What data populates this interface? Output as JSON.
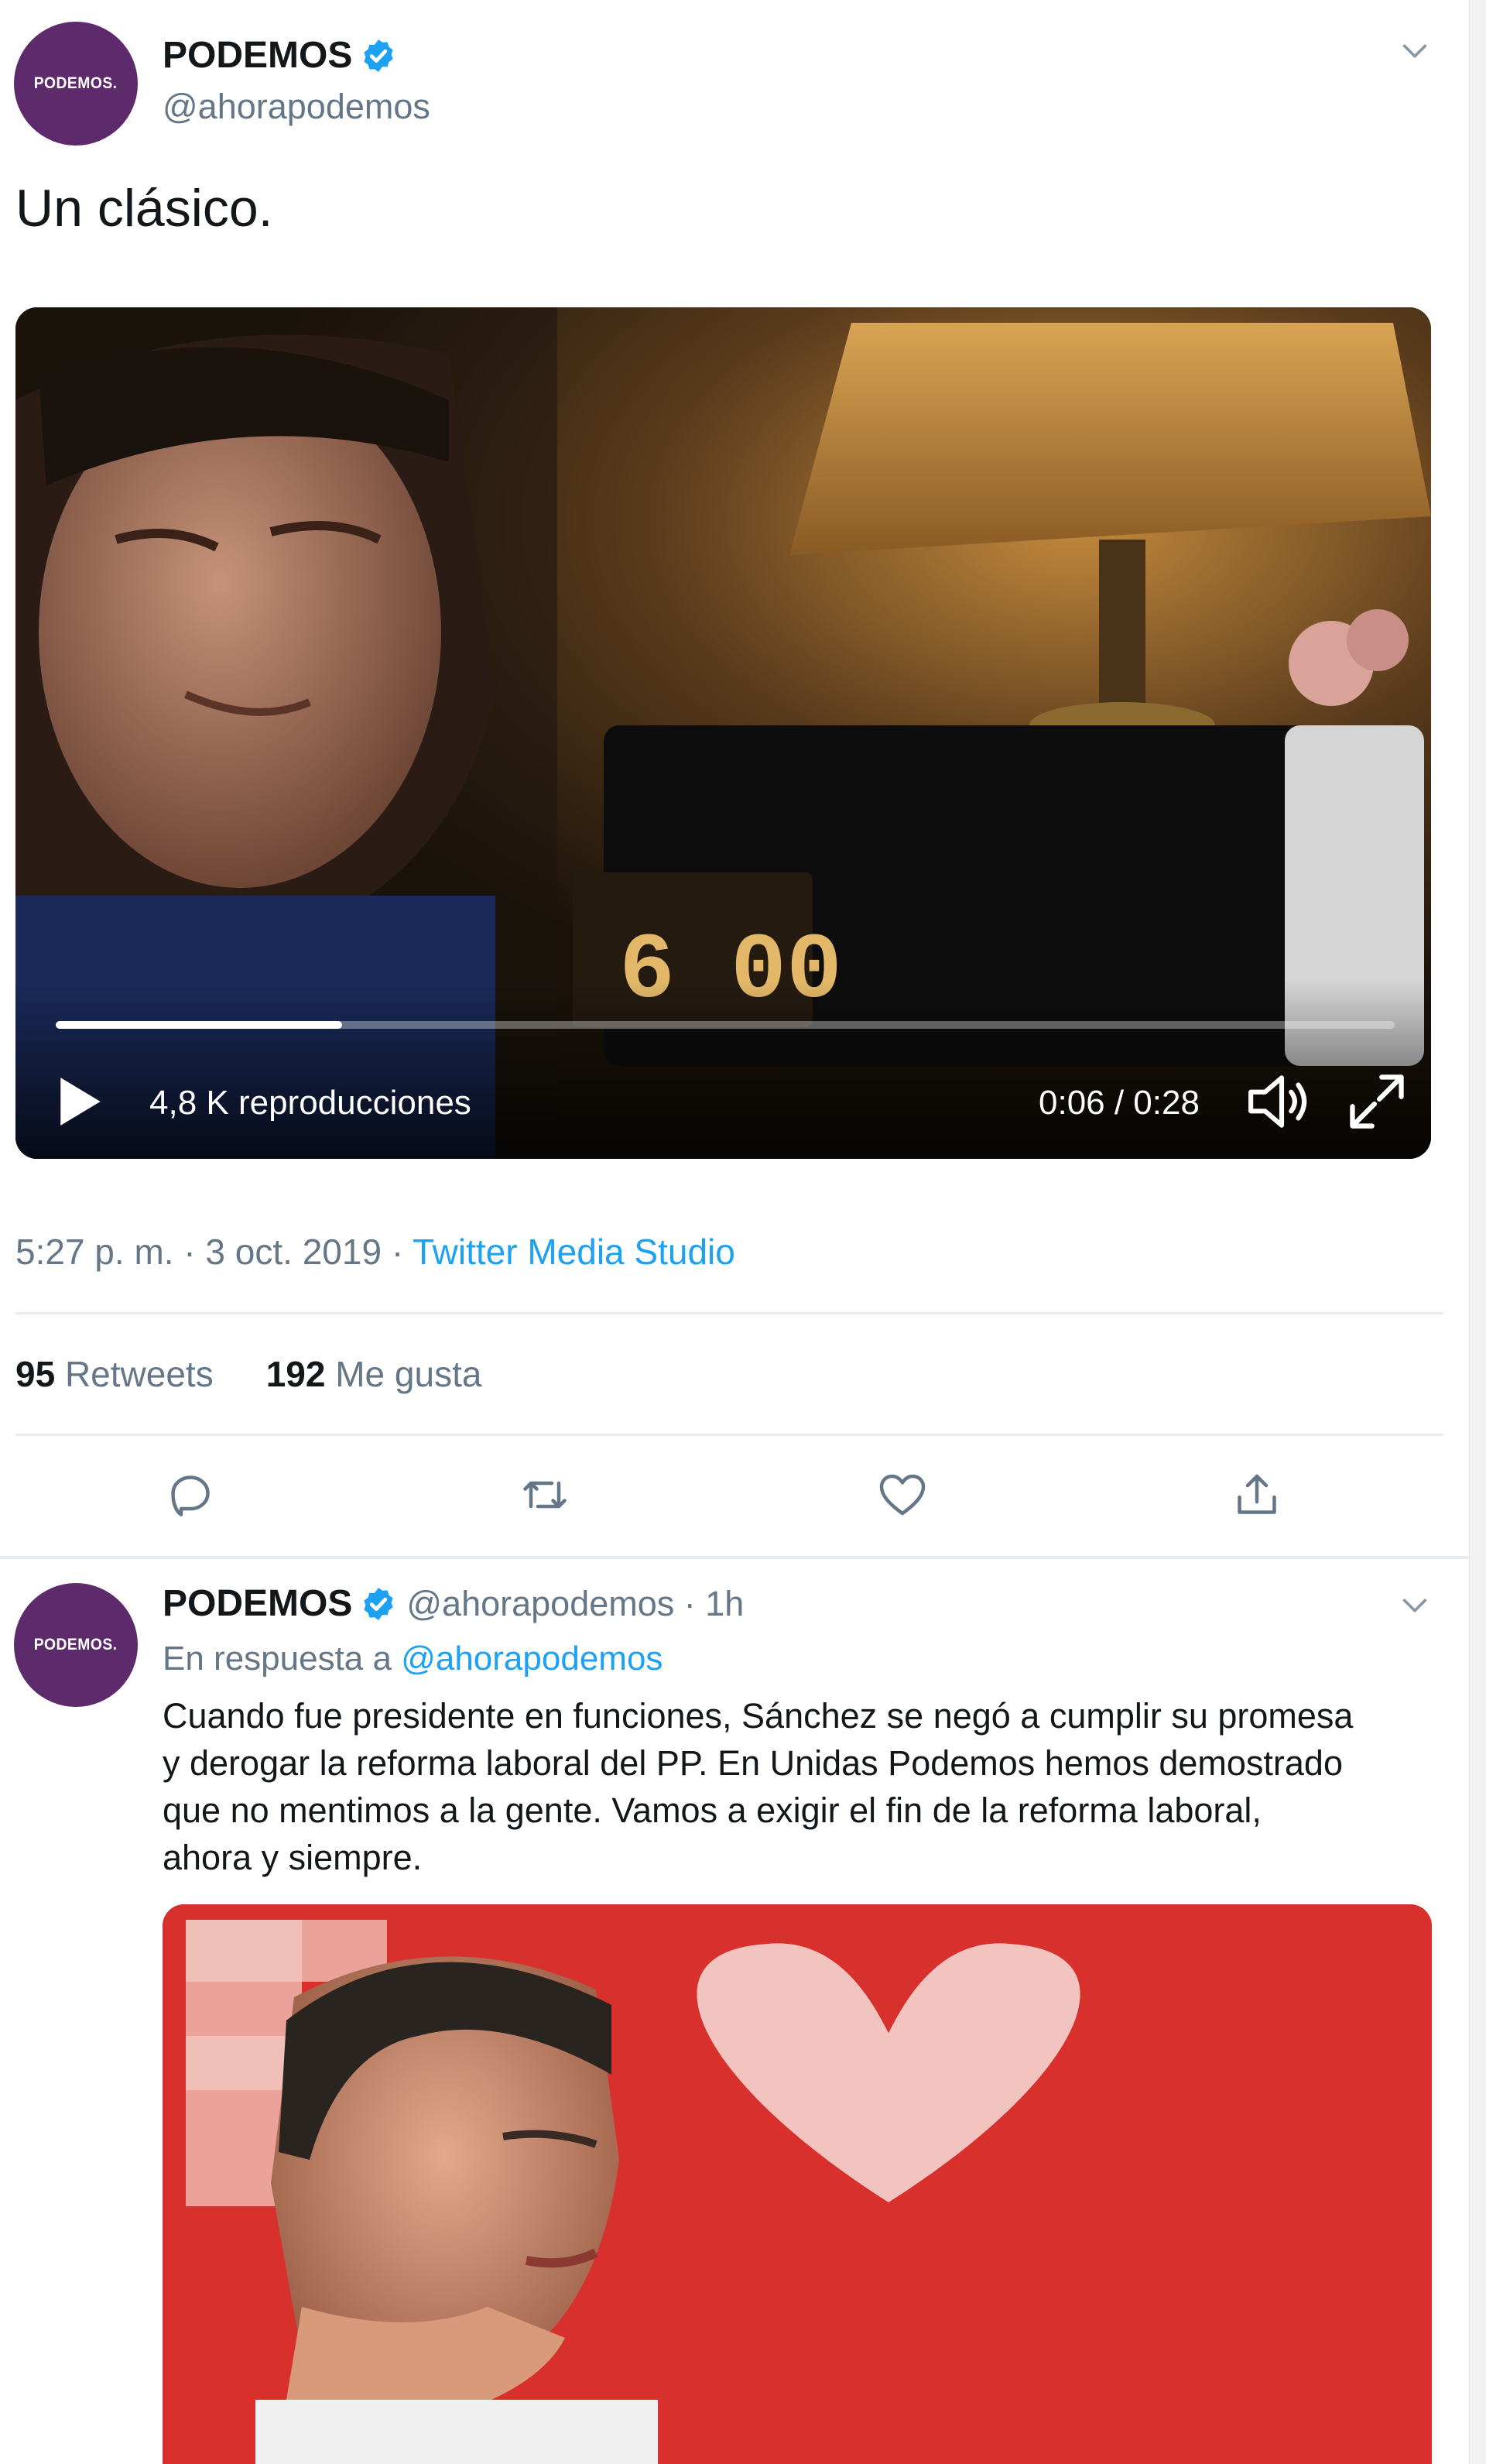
{
  "main_tweet": {
    "avatar_text": "PODEMOS.",
    "display_name": "PODEMOS",
    "handle": "@ahorapodemos",
    "text": "Un clásico.",
    "video": {
      "views": "4,8 K reproducciones",
      "time": "0:06 / 0:28",
      "progress": 0.214,
      "clock_display": "6 00"
    },
    "time_prefix": "5:27 p. m. · 3 oct. 2019 · ",
    "source": "Twitter Media Studio",
    "retweets_count": "95",
    "retweets_label": "Retweets",
    "likes_count": "192",
    "likes_label": "Me gusta"
  },
  "reply_tweet": {
    "avatar_text": "PODEMOS.",
    "display_name": "PODEMOS",
    "handle_time": "@ahorapodemos · 1h",
    "in_reply_prefix": "En respuesta a ",
    "in_reply_handle": "@ahorapodemos",
    "text_lines": [
      "Cuando fue presidente en funciones, Sánchez se negó a cumplir su promesa",
      "y derogar la reforma laboral del PP. En Unidas Podemos hemos demostrado",
      "que no mentimos a la gente. Vamos a exigir el fin de la reforma laboral,",
      "ahora y siempre."
    ]
  },
  "colors": {
    "brand_purple": "#5d2a6b",
    "link_blue": "#1da1f2",
    "secondary_text": "#657786",
    "divider": "#e6ecf0"
  },
  "icons": [
    "verified-badge-icon",
    "chevron-down-icon",
    "play-icon",
    "volume-icon",
    "fullscreen-icon",
    "reply-icon",
    "retweet-icon",
    "like-icon",
    "share-icon"
  ]
}
